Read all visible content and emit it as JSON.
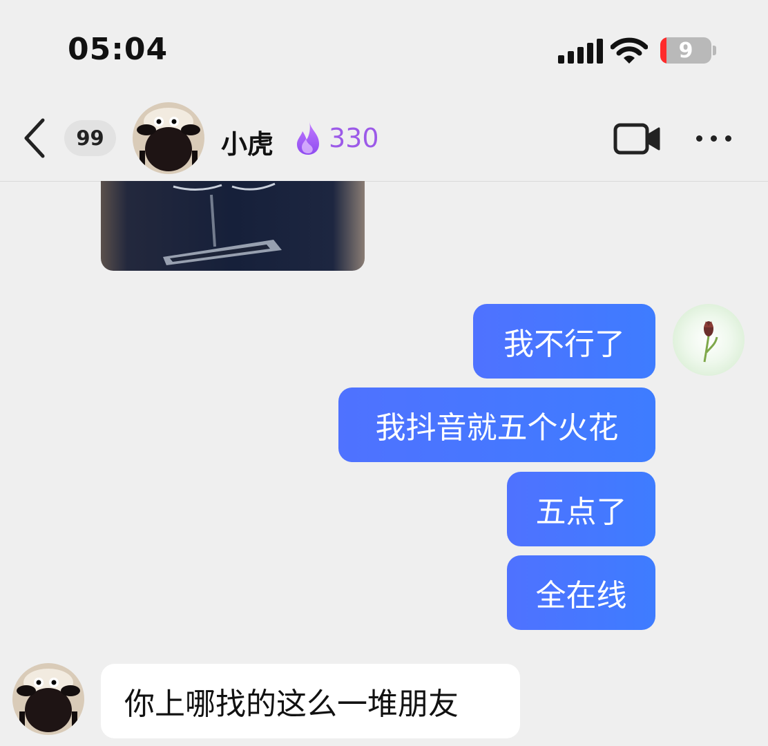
{
  "status_bar": {
    "time": "05:04",
    "battery": "9"
  },
  "header": {
    "back_badge": "99",
    "contact_name": "小虎",
    "streak_count": "330"
  },
  "messages": {
    "sent": [
      "我不行了",
      "我抖音就五个火花",
      "五点了",
      "全在线"
    ],
    "received": [
      "你上哪找的这么一堆朋友"
    ]
  },
  "icons": {
    "back": "chevron-left-icon",
    "streak": "flame-icon",
    "video": "video-camera-icon",
    "more": "more-dots-icon",
    "signal": "cellular-signal-icon",
    "wifi": "wifi-icon",
    "battery": "battery-icon"
  },
  "colors": {
    "sent_bubble": "#4f72ff",
    "received_bubble": "#ffffff",
    "streak": "#9c5ae8",
    "background": "#efefef",
    "battery_low": "#ff2b2b"
  }
}
